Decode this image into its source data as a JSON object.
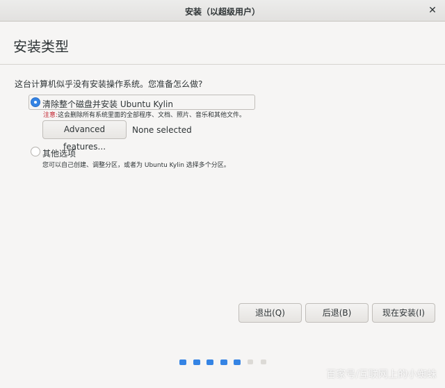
{
  "window": {
    "title": "安装（以超级用户）"
  },
  "page": {
    "title": "安装类型"
  },
  "question": "这台计算机似乎没有安装操作系统。您准备怎么做?",
  "option_erase": {
    "label": "清除整个磁盘并安装 Ubuntu Kylin",
    "selected": true,
    "warning_label": "注意:",
    "warning_text": "这会删除所有系统里面的全部程序、文档、照片、音乐和其他文件。",
    "advanced_button": "Advanced features...",
    "advanced_status": "None selected"
  },
  "option_other": {
    "label": "其他选项",
    "selected": false,
    "description": "您可以自己创建、调整分区，或者为 Ubuntu Kylin 选择多个分区。"
  },
  "buttons": {
    "quit": "退出(Q)",
    "back": "后退(B)",
    "install": "现在安装(I)"
  },
  "progress": {
    "total_steps": 7,
    "completed_steps": 5,
    "active_color": "#3584e4",
    "inactive_color": "#dcdad6"
  },
  "watermark": "百家号/互联网上的小蜘蛛",
  "icons": {
    "close": "close-icon"
  }
}
